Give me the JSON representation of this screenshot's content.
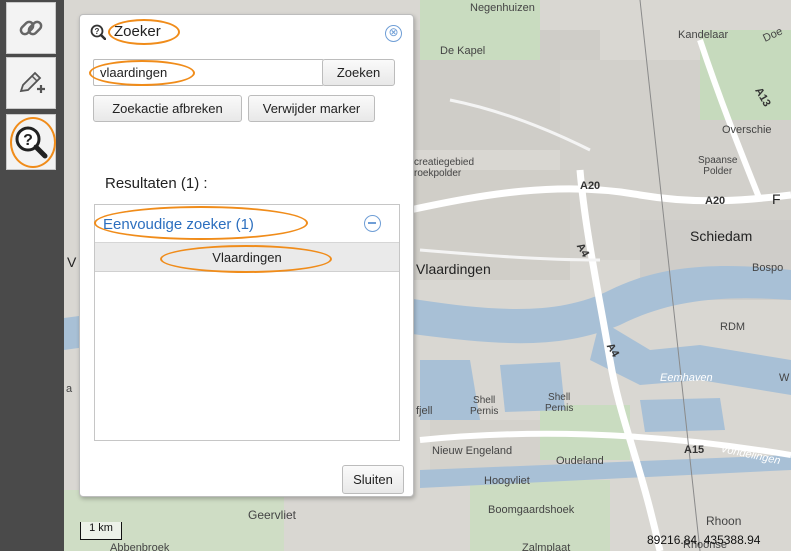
{
  "map": {
    "labels": {
      "negenhuizen": "Negenhuizen",
      "kandelaar": "Kandelaar",
      "doe": "Doe",
      "de_kapel": "De Kapel",
      "overschie": "Overschie",
      "recreatie": "creatiegebied\nroekpolder",
      "spaanse_polder": "Spaanse\nPolder",
      "a20_1": "A20",
      "a20_2": "A20",
      "a13": "A13",
      "schiedam": "Schiedam",
      "f": "F",
      "bospo": "Bospo",
      "a4_1": "A4",
      "a4_2": "A4",
      "vlaardingen": "Vlaardingen",
      "v_edge": "V",
      "rdm": "RDM",
      "eemhaven": "Eemhaven",
      "w_edge": "W",
      "a_edge": "a",
      "fjell": "fjell",
      "shell_pernis_1": "Shell\nPernis",
      "shell_pernis_2": "Shell\nPernis",
      "nieuw_engeland": "Nieuw Engeland",
      "oudeland": "Oudeland",
      "a15": "A15",
      "vondelingen": "Vondelingen",
      "hoogvliet": "Hoogvliet",
      "boomgaardshoek": "Boomgaardshoek",
      "geervliet": "Geervliet",
      "rhoon": "Rhoon",
      "abbenbroek": "Abbenbroek",
      "zalmplaat": "Zalmplaat",
      "rhoonse": "Rhoonse"
    }
  },
  "toolbar": {
    "tools": [
      {
        "icon": "link-icon"
      },
      {
        "icon": "edit-pencil-icon"
      },
      {
        "icon": "search-help-icon"
      }
    ]
  },
  "search_panel": {
    "title": "Zoeker",
    "close_symbol": "⊗",
    "query_value": "vlaardingen",
    "search_button": "Zoeken",
    "abort_button": "Zoekactie afbreken",
    "remove_marker_button": "Verwijder marker",
    "results_title": "Resultaten (1) :",
    "result_group_label": "Eenvoudige zoeker (1)",
    "results": [
      "Vlaardingen"
    ],
    "close_button": "Sluiten"
  },
  "footer": {
    "scale_label": "1 km",
    "coordinates": "89216.84, 435388.94"
  },
  "colors": {
    "highlight": "#f08c1a",
    "link_blue": "#2c6fbf",
    "water": "#a8c0d6",
    "toolbar": "#4a4a4a"
  }
}
